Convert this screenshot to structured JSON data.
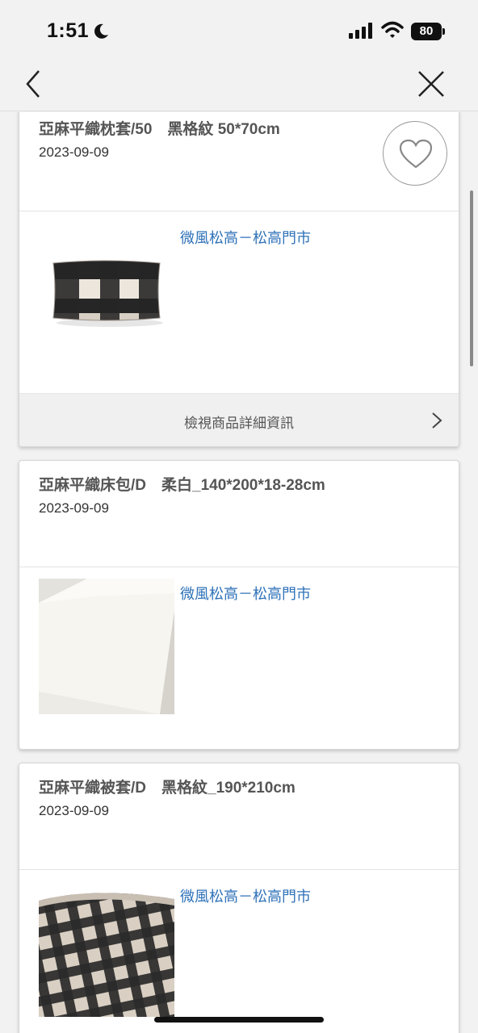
{
  "status_bar": {
    "time": "1:51",
    "battery": "80"
  },
  "nav": {
    "back_icon": "chevron-left-icon",
    "close_icon": "close-icon"
  },
  "products": [
    {
      "title": "亞麻平織枕套/50　黑格紋 50*70cm",
      "date": "2023-09-09",
      "store": "微風松高－松高門市",
      "detail_label": "檢視商品詳細資訊",
      "favorite_icon": "heart-icon"
    },
    {
      "title": "亞麻平織床包/D　柔白_140*200*18-28cm",
      "date": "2023-09-09",
      "store": "微風松高－松高門市"
    },
    {
      "title": "亞麻平織被套/D　黑格紋_190*210cm",
      "date": "2023-09-09",
      "store": "微風松高－松高門市"
    }
  ],
  "colors": {
    "link": "#2f72b8",
    "background": "#f2f2f2",
    "card": "#ffffff"
  }
}
